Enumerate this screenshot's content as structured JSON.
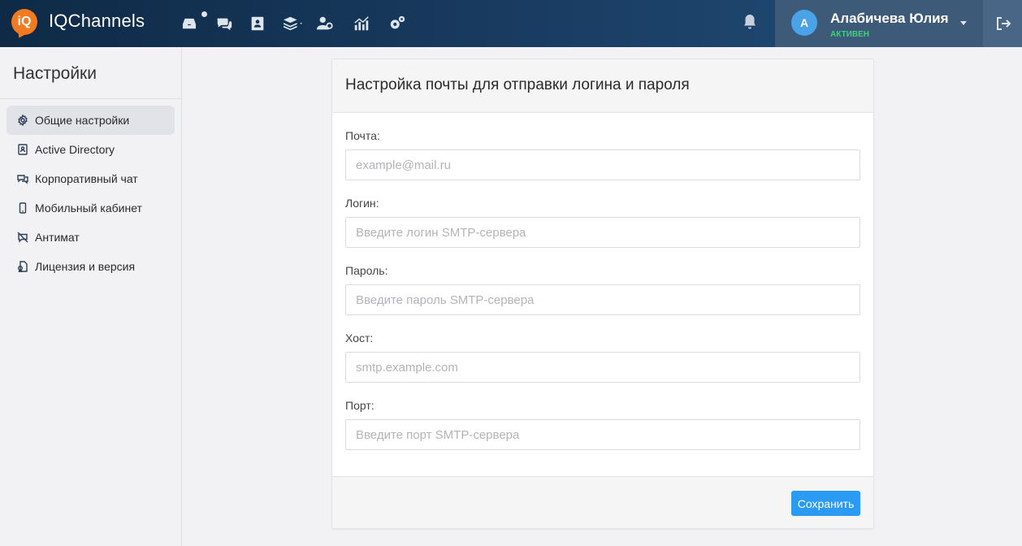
{
  "header": {
    "logo_text": "iQ",
    "brand": "IQChannels",
    "nav_icons": [
      "inbox-icon",
      "chats-icon",
      "contacts-icon",
      "layers-icon",
      "users-icon",
      "analytics-icon",
      "settings-icon"
    ],
    "notification_icon": "bell-icon",
    "user": {
      "avatar_letter": "А",
      "name": "Алабичева Юлия",
      "status": "АКТИВЕН"
    },
    "logout_icon": "logout-icon"
  },
  "sidebar": {
    "title": "Настройки",
    "items": [
      {
        "label": "Общие настройки",
        "icon": "gear-icon",
        "active": true
      },
      {
        "label": "Active Directory",
        "icon": "contact-card-icon",
        "active": false
      },
      {
        "label": "Корпоративный чат",
        "icon": "chat-bubbles-icon",
        "active": false
      },
      {
        "label": "Мобильный кабинет",
        "icon": "mobile-phone-icon",
        "active": false
      },
      {
        "label": "Антимат",
        "icon": "muted-chat-icon",
        "active": false
      },
      {
        "label": "Лицензия и версия",
        "icon": "license-icon",
        "active": false
      }
    ]
  },
  "form": {
    "title": "Настройка почты для отправки логина и пароля",
    "fields": [
      {
        "label": "Почта:",
        "value": "",
        "placeholder": "example@mail.ru"
      },
      {
        "label": "Логин:",
        "value": "",
        "placeholder": "Введите логин SMTP-сервера"
      },
      {
        "label": "Пароль:",
        "value": "",
        "placeholder": "Введите пароль SMTP-сервера"
      },
      {
        "label": "Хост:",
        "value": "",
        "placeholder": "smtp.example.com"
      },
      {
        "label": "Порт:",
        "value": "",
        "placeholder": "Введите порт SMTP-сервера"
      }
    ],
    "save_label": "Сохранить"
  },
  "colors": {
    "header_bg": "#0e2a46",
    "accent": "#2b9af3",
    "status_active": "#3ed17b",
    "logo": "#f47a1f"
  }
}
